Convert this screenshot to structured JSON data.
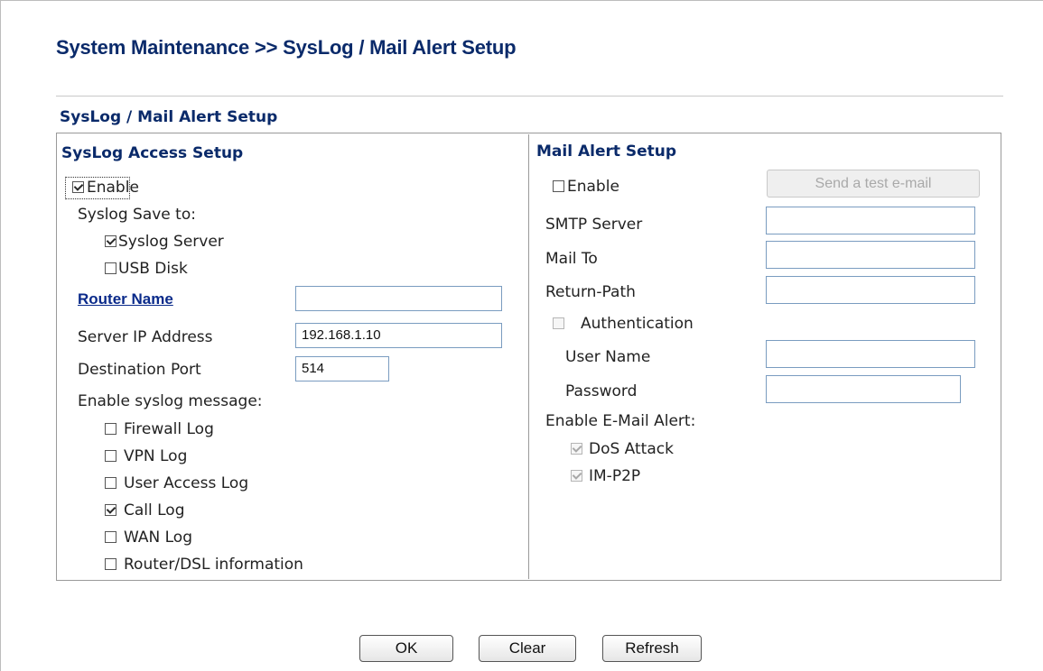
{
  "page": {
    "title": "System Maintenance >> SysLog / Mail Alert Setup",
    "section_caption": "SysLog / Mail Alert Setup"
  },
  "syslog": {
    "header": "SysLog Access Setup",
    "enable_label": "Enable",
    "enable_checked": true,
    "save_to_label": "Syslog Save to:",
    "save_to": [
      {
        "label": "Syslog Server",
        "checked": true
      },
      {
        "label": "USB Disk",
        "checked": false
      }
    ],
    "router_name_label": "Router Name",
    "router_name_value": "",
    "server_ip_label": "Server IP Address",
    "server_ip_value": "192.168.1.10",
    "dest_port_label": "Destination Port",
    "dest_port_value": "514",
    "messages_label": "Enable syslog message:",
    "messages": [
      {
        "label": "Firewall Log",
        "checked": false
      },
      {
        "label": "VPN Log",
        "checked": false
      },
      {
        "label": "User Access Log",
        "checked": false
      },
      {
        "label": "Call Log",
        "checked": true
      },
      {
        "label": "WAN Log",
        "checked": false
      },
      {
        "label": "Router/DSL information",
        "checked": false
      }
    ]
  },
  "mail": {
    "header": "Mail Alert Setup",
    "enable_label": "Enable",
    "enable_checked": false,
    "test_button": "Send a test e-mail",
    "smtp_label": "SMTP Server",
    "smtp_value": "",
    "mail_to_label": "Mail To",
    "mail_to_value": "",
    "return_path_label": "Return-Path",
    "return_path_value": "",
    "auth_label": "Authentication",
    "auth_checked": false,
    "username_label": "User Name",
    "username_value": "",
    "password_label": "Password",
    "password_value": "",
    "alert_label": "Enable E-Mail Alert:",
    "alerts": [
      {
        "label": "DoS Attack",
        "checked": true
      },
      {
        "label": "IM-P2P",
        "checked": true
      }
    ]
  },
  "actions": {
    "ok": "OK",
    "clear": "Clear",
    "refresh": "Refresh"
  }
}
